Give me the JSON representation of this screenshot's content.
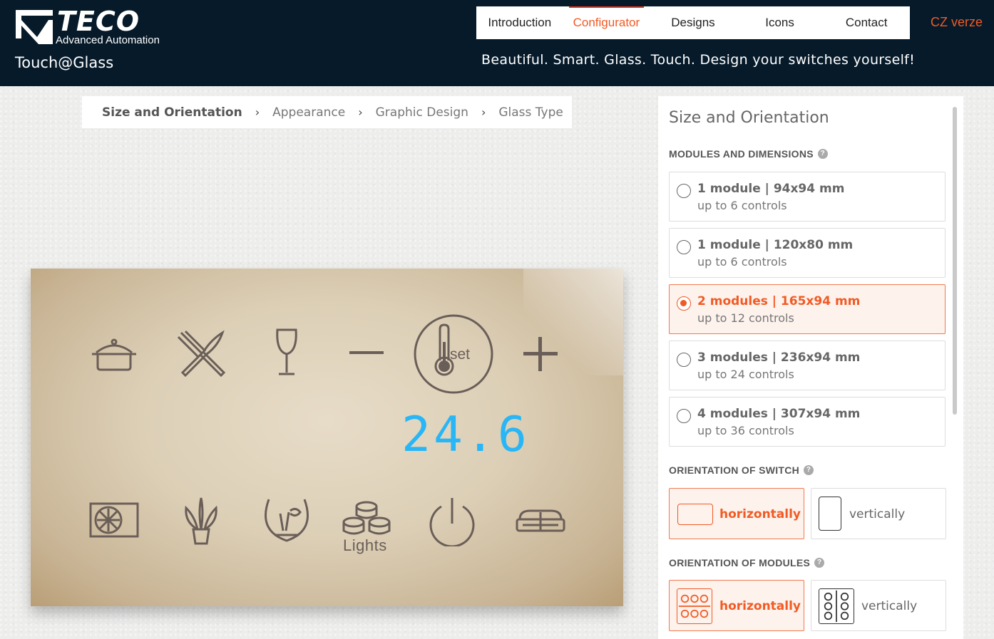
{
  "header": {
    "logo_text": "TECO",
    "logo_subtitle": "Advanced Automation",
    "brand": "Touch@Glass",
    "tagline": "Beautiful. Smart. Glass. Touch. Design your switches yourself!",
    "lang_link": "CZ verze",
    "nav": [
      {
        "label": "Introduction",
        "active": false
      },
      {
        "label": "Configurator",
        "active": true
      },
      {
        "label": "Designs",
        "active": false
      },
      {
        "label": "Icons",
        "active": false
      },
      {
        "label": "Contact",
        "active": false
      }
    ],
    "colors": {
      "bg": "#061a2a",
      "accent": "#f15a24"
    }
  },
  "steps": [
    {
      "label": "Size and Orientation",
      "current": true
    },
    {
      "label": "Appearance",
      "current": false
    },
    {
      "label": "Graphic Design",
      "current": false
    },
    {
      "label": "Glass Type",
      "current": false
    }
  ],
  "preview": {
    "display_value": "24.6",
    "display_color": "#29b6f6",
    "thermostat_label": "set",
    "lights_label": "Lights",
    "top_row_icons": [
      "pot-icon",
      "fork-knife-icon",
      "wine-glass-icon",
      "minus-icon",
      "thermometer-set-icon",
      "plus-icon"
    ],
    "bottom_row_icons": [
      "fan-icon",
      "plant-icon",
      "aquarium-icon",
      "lights-icon",
      "power-icon",
      "sofa-icon"
    ]
  },
  "panel": {
    "title": "Size and Orientation",
    "modules_label": "MODULES AND DIMENSIONS",
    "modules": [
      {
        "title": "1 module | 94x94 mm",
        "sub": "up to 6 controls",
        "selected": false
      },
      {
        "title": "1 module | 120x80 mm",
        "sub": "up to 6 controls",
        "selected": false
      },
      {
        "title": "2 modules | 165x94 mm",
        "sub": "up to 12 controls",
        "selected": true
      },
      {
        "title": "3 modules | 236x94 mm",
        "sub": "up to 24 controls",
        "selected": false
      },
      {
        "title": "4 modules | 307x94 mm",
        "sub": "up to 36 controls",
        "selected": false
      }
    ],
    "switch_orientation_label": "ORIENTATION OF SWITCH",
    "switch_orientation": {
      "horizontal": "horizontally",
      "vertical": "vertically",
      "selected": "horizontally"
    },
    "modules_orientation_label": "ORIENTATION OF MODULES",
    "modules_orientation": {
      "horizontal": "horizontally",
      "vertical": "vertically",
      "selected": "horizontally"
    },
    "help_glyph": "?"
  }
}
